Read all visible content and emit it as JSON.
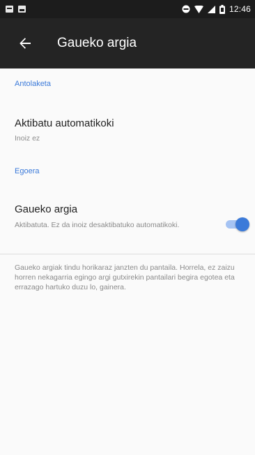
{
  "status_bar": {
    "time": "12:46",
    "icons": [
      "notification-icon",
      "image-notification-icon",
      "do-not-disturb-icon",
      "wifi-icon",
      "signal-icon",
      "battery-icon"
    ]
  },
  "app_bar": {
    "title": "Gaueko argia",
    "back_icon": "arrow-back-icon",
    "background": "#242424"
  },
  "sections": {
    "settings_header": "Antolaketa",
    "status_header": "Egoera"
  },
  "auto_activate": {
    "title": "Aktibatu automatikoki",
    "summary": "Inoiz ez"
  },
  "night_light": {
    "title": "Gaueko argia",
    "summary": "Aktibatuta. Ez da inoiz desaktibatuko automatikoki.",
    "switch_on": true
  },
  "footer": {
    "text": "Gaueko argiak tindu horikaraz janzten du pantaila. Horrela, ez zaizu horren nekagarria egingo argi gutxirekin pantailari begira egotea eta errazago hartuko duzu lo, gainera."
  },
  "colors": {
    "accent": "#3b7ad9",
    "background": "#fafafa"
  }
}
